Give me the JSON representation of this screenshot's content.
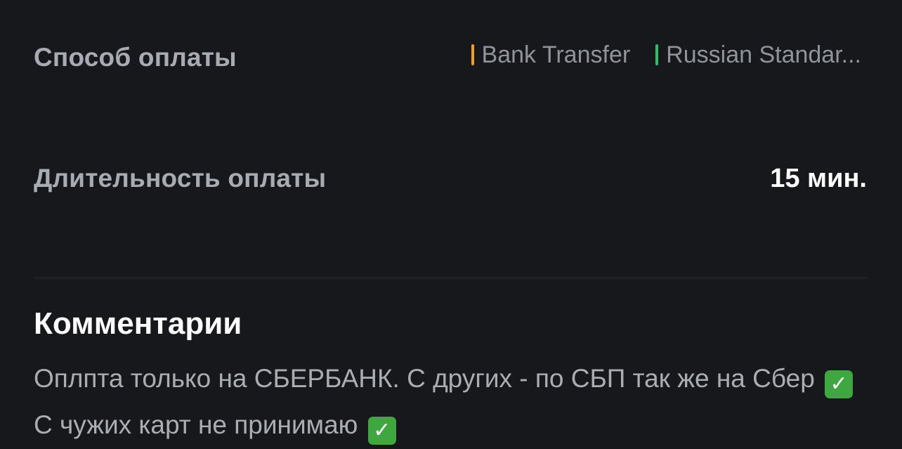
{
  "payment_method": {
    "label": "Способ оплаты",
    "methods": [
      {
        "name": "Bank Transfer",
        "color": "#f0a020"
      },
      {
        "name": "Russian Standar...",
        "color": "#2ebd6b"
      }
    ]
  },
  "payment_duration": {
    "label": "Длительность оплаты",
    "value": "15 мин."
  },
  "comments": {
    "title": "Комментарии",
    "text_part1": "Оплпта только на  СБЕРБАНК.  С других - по СБП так же на Сбер",
    "text_part2": "С чужих карт не принимаю",
    "check_glyph": "✓",
    "check_icon": "check-mark-icon",
    "check_color": "#3fa73f"
  }
}
